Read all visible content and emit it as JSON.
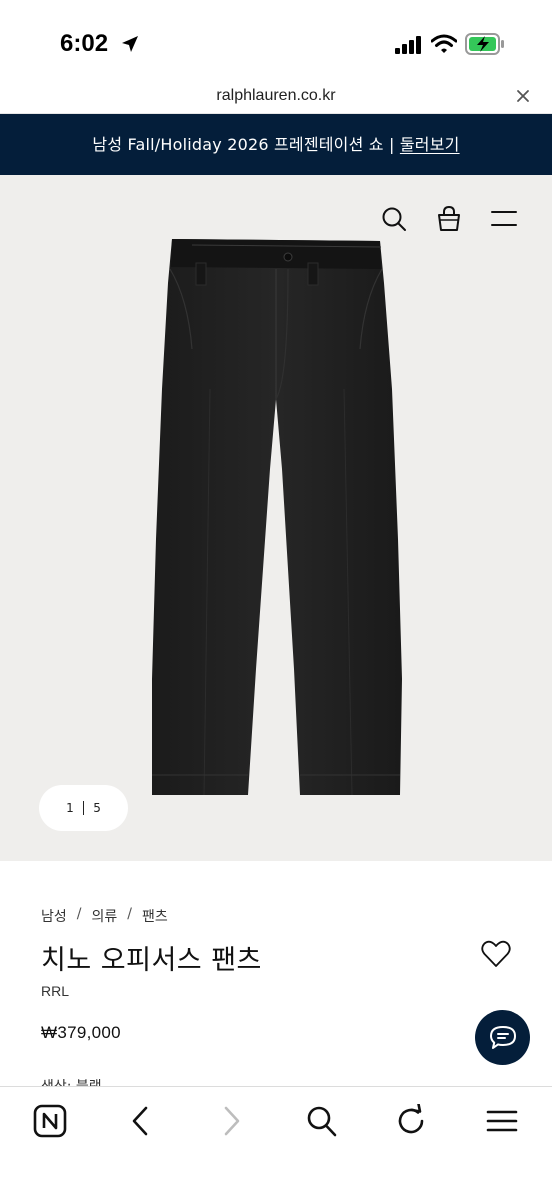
{
  "status_bar": {
    "time": "6:02"
  },
  "browser": {
    "url": "ralphlauren.co.kr"
  },
  "promo": {
    "text": "남성 Fall/Holiday 2026 프레젠테이션 쇼 | ",
    "link": "둘러보기"
  },
  "gallery": {
    "current_page": "1",
    "total_pages": "5"
  },
  "product": {
    "breadcrumb": [
      "남성",
      "의류",
      "팬츠"
    ],
    "breadcrumb_separator": "/",
    "name": "치노 오피서스 팬츠",
    "brand": "RRL",
    "price": "₩379,000",
    "color_label": "색상: 블랙"
  },
  "colors": {
    "navy": "#041e3a",
    "hero_bg": "#efeeec",
    "battery": "#34c759"
  },
  "icons": [
    "location-arrow-icon",
    "signal-icon",
    "wifi-icon",
    "battery-charging-icon",
    "close-icon",
    "search-icon",
    "bag-icon",
    "menu-icon",
    "heart-icon",
    "chat-icon",
    "naver-home-icon",
    "back-icon",
    "forward-icon",
    "tabs-search-icon",
    "refresh-icon",
    "browser-menu-icon"
  ]
}
